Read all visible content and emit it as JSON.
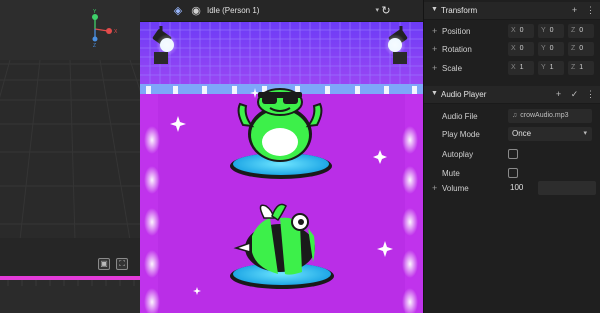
{
  "toolbar": {
    "person_select": "Idle (Person 1)",
    "icons": [
      "cube-icon",
      "camera-icon",
      "chevron-down-icon",
      "refresh-icon"
    ]
  },
  "gizmo": {
    "y": "Y",
    "x": "X",
    "z": "Z"
  },
  "inspector": {
    "transform": {
      "title": "Transform",
      "rows": [
        {
          "label": "Position",
          "x": "0",
          "y": "0",
          "z": "0"
        },
        {
          "label": "Rotation",
          "x": "0",
          "y": "0",
          "z": "0"
        },
        {
          "label": "Scale",
          "x": "1",
          "y": "1",
          "z": "1"
        }
      ],
      "axis_labels": {
        "x": "X",
        "y": "Y",
        "z": "Z"
      }
    },
    "audio": {
      "title": "Audio Player",
      "audio_file_label": "Audio File",
      "audio_file_value": "crowAudio.mp3",
      "play_mode_label": "Play Mode",
      "play_mode_value": "Once",
      "autoplay_label": "Autoplay",
      "mute_label": "Mute",
      "volume_label": "Volume",
      "volume_value": "100"
    }
  },
  "colors": {
    "stage_purple": "#c236ee",
    "grid_blue": "#7a4cff",
    "frog_green": "#3df04a",
    "pad_cyan": "#29c8f2",
    "accent_magenta": "#e33bd9"
  }
}
